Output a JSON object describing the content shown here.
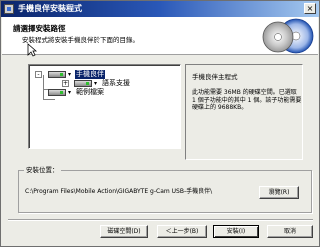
{
  "window": {
    "title": "手機良伴安裝程式"
  },
  "header": {
    "title": "請選擇安裝路徑",
    "description": "安裝程式將安裝手機良伴於下面的目錄。"
  },
  "tree": {
    "items": [
      {
        "label": "手機良伴",
        "selected": true,
        "expander": "-"
      },
      {
        "label": "語系支援",
        "selected": false,
        "expander": "+"
      },
      {
        "label": "範例檔案",
        "selected": false,
        "expander": ""
      }
    ]
  },
  "info_panel": {
    "title": "手機良伴主程式",
    "description": "此功能需要 36MB 的硬碟空間。已選取 1 個子功能中的其中 1 個。該子功能需要硬碟上的 9688KB。"
  },
  "install_location": {
    "label": "安裝位置：",
    "path": "C:\\Program Files\\Mobile Action\\GIGABYTE g-Cam USB-手機良伴\\",
    "browse_button": "瀏覽(R)"
  },
  "buttons": {
    "disk_space": "磁碟空間(D)",
    "back": "＜上一步(B)",
    "install": "安裝(I)",
    "cancel": "取消"
  },
  "colors": {
    "title_bar_start": "#0a246a",
    "title_bar_end": "#a6caf0",
    "selection": "#0a246a",
    "dialog_background": "#ecece6"
  },
  "icons": [
    "installer-app-icon",
    "close-icon",
    "cd-disc-icon",
    "mouse-cursor-icon",
    "drive-icon"
  ]
}
